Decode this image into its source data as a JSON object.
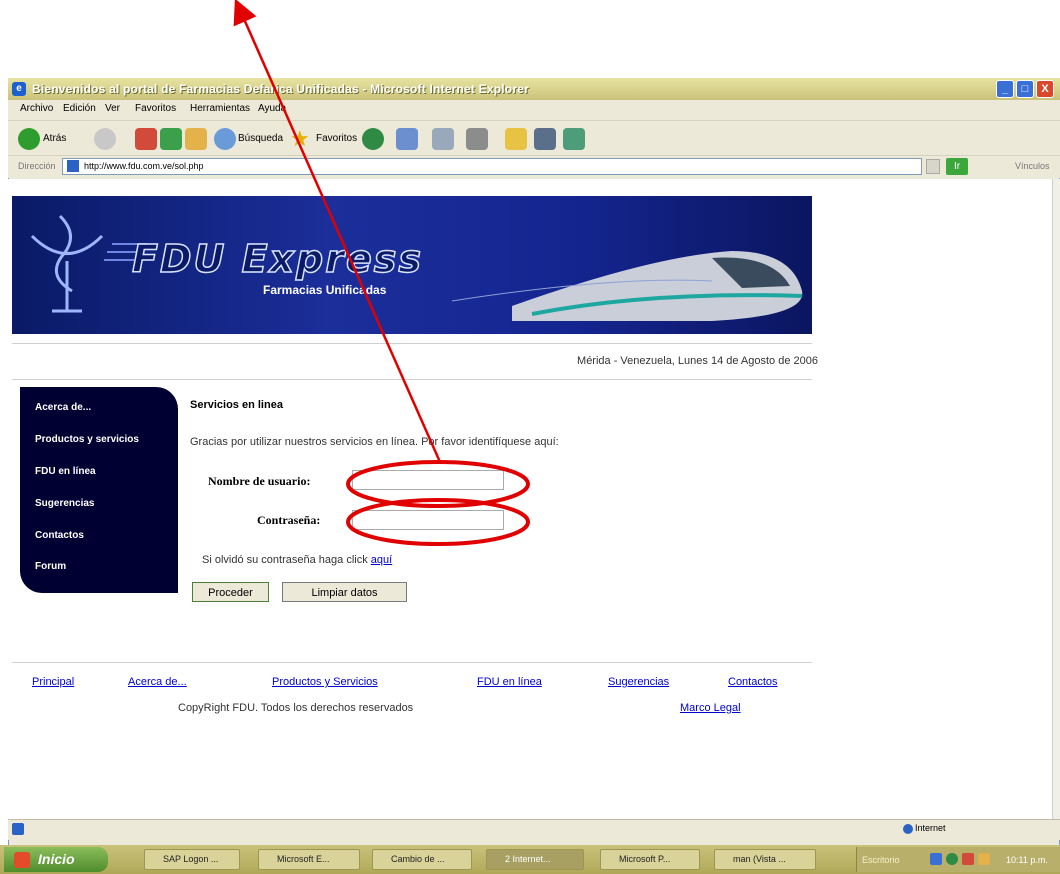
{
  "window": {
    "title": "Bienvenidos al portal de Farmacias Defarica Unificadas - Microsoft Internet Explorer",
    "minimize": "_",
    "maximize": "□",
    "close": "X"
  },
  "menubar": {
    "items": [
      "Archivo",
      "Edición",
      "Ver",
      "Favoritos",
      "Herramientas",
      "Ayuda"
    ]
  },
  "toolbar": {
    "back_label": "Atrás",
    "search_label": "Búsqueda",
    "favorites_label": "Favoritos"
  },
  "addressbar": {
    "label": "Dirección",
    "url": "http://www.fdu.com.ve/sol.php",
    "go_label": "Ir",
    "links_label": "Vínculos"
  },
  "page": {
    "brand_title": "FDU Express",
    "brand_subtitle": "Farmacias Unificadas",
    "date_line": "Mérida - Venezuela, Lunes 14 de Agosto de 2006",
    "sidebar": [
      {
        "label": "Acerca de..."
      },
      {
        "label": "Productos y servicios"
      },
      {
        "label": "FDU en línea"
      },
      {
        "label": "Sugerencias"
      },
      {
        "label": "Contactos"
      },
      {
        "label": "Forum"
      }
    ],
    "services_title": "Servicios en linea",
    "services_desc": "Gracias por utilizar nuestros servicios en línea. Por favor identifíquese aquí:",
    "username_label": "Nombre de usuario:",
    "username_value": "",
    "password_label": "Contraseña:",
    "password_value": "",
    "forgot_text": "Si olvidó su contraseña haga click ",
    "forgot_link": "aquí",
    "proceed_button": "Proceder",
    "clear_button": "Limpiar datos",
    "footer_links": [
      "Principal",
      "Acerca de...",
      "Productos y Servicios",
      "FDU en línea",
      "Sugerencias",
      "Contactos"
    ],
    "copyright": "CopyRight FDU. Todos los derechos reservados",
    "legal_link": "Marco Legal"
  },
  "statusbar": {
    "zone": "Internet"
  },
  "taskbar": {
    "start_label": "Inicio",
    "tasks": [
      {
        "label": "SAP Logon ...",
        "active": false
      },
      {
        "label": "Microsoft E...",
        "active": false
      },
      {
        "label": "Cambio de ...",
        "active": false
      },
      {
        "label": "2 Internet...",
        "active": true
      },
      {
        "label": "Microsoft P...",
        "active": false
      },
      {
        "label": "man (Vista ...",
        "active": false
      }
    ],
    "tray_label": "Escritorio",
    "clock": "10:11 p.m."
  },
  "colors": {
    "banner": "#142590",
    "sidebar": "#000033",
    "annotation": "#e00000"
  }
}
